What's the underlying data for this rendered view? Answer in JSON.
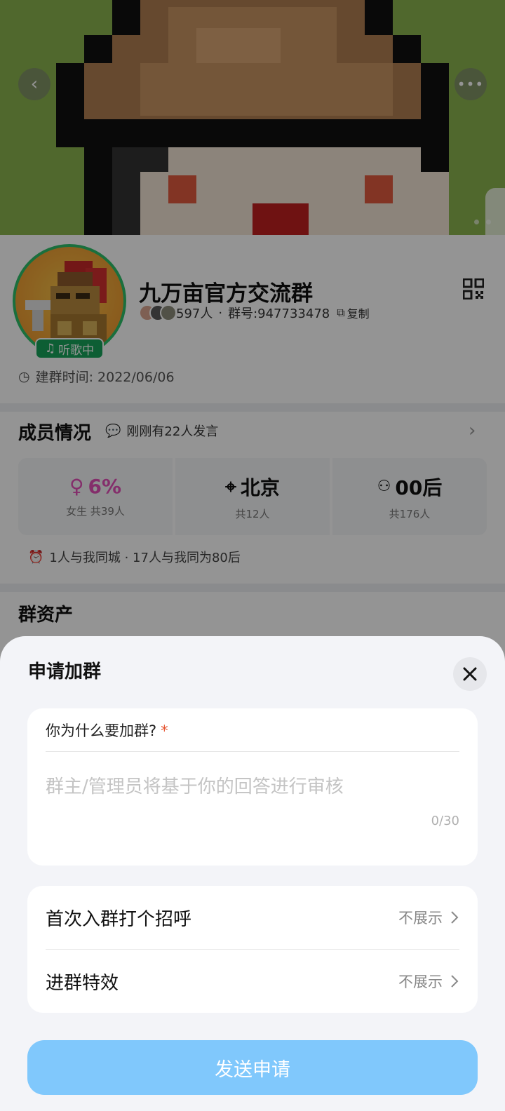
{
  "hero": {
    "back_icon": "chevron-left-icon",
    "more_icon": "more-icon"
  },
  "group": {
    "name": "九万亩官方交流群",
    "members": "597人",
    "separator": "·",
    "group_number": "群号:947733478",
    "copy_label": "复制",
    "music_status": "听歌中",
    "created": "建群时间: 2022/06/06"
  },
  "member_stats": {
    "title": "成员情况",
    "recent_activity": "刚刚有22人发言",
    "cards": [
      {
        "main": "6%",
        "sub": "女生 共39人",
        "icon": "female-icon"
      },
      {
        "main": "北京",
        "sub": "共12人",
        "icon": "location-icon"
      },
      {
        "main": "00后",
        "sub": "共176人",
        "icon": "person-icon"
      }
    ],
    "same_city": "1人与我同城 · 17人与我同为80后"
  },
  "assets": {
    "title": "群资产"
  },
  "sheet": {
    "title": "申请加群",
    "question_label": "你为什么要加群?",
    "required_mark": "*",
    "answer_value": "",
    "answer_placeholder": "群主/管理员将基于你的回答进行审核",
    "counter": "0/30",
    "options": [
      {
        "label": "首次入群打个招呼",
        "value": "不展示"
      },
      {
        "label": "进群特效",
        "value": "不展示"
      }
    ],
    "send_label": "发送申请"
  },
  "colors": {
    "accent": "#80c8fc",
    "pink": "#e350b8",
    "green_badge": "#18a35a",
    "required": "#e5532f"
  }
}
